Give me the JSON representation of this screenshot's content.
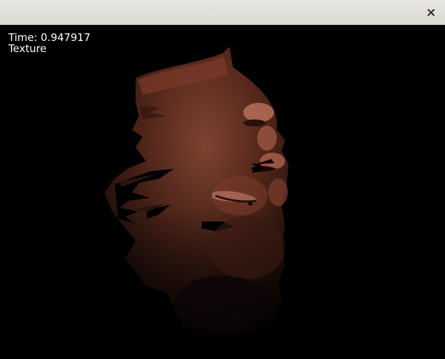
{
  "window": {
    "title": "",
    "close_icon": "close-icon"
  },
  "overlay": {
    "time_label": "Time: 0.947917",
    "mode_label": "Texture"
  },
  "scene": {
    "description_icon": "textured-face-mesh",
    "background_color": "#000000",
    "skin_color": "#6e3424"
  }
}
